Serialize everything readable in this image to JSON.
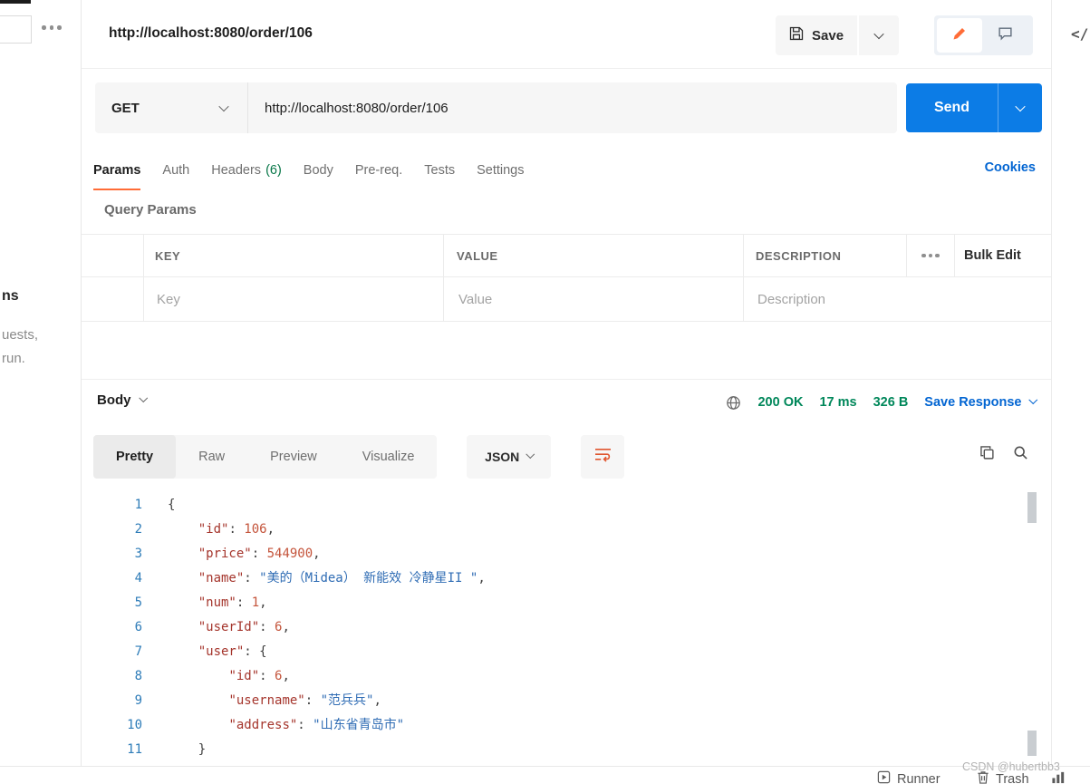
{
  "colors": {
    "accent_orange": "#FF6C37",
    "send_blue": "#0C7CE6",
    "link_blue": "#0265D2",
    "success_green": "#00875A",
    "code_key": "#A5352C",
    "code_number": "#C4543B",
    "code_string": "#2F6CB4",
    "code_line_number": "#2E7CB8"
  },
  "sidebar": {
    "line1": "ns",
    "line2": "uests,",
    "line3": "run."
  },
  "header": {
    "title": "http://localhost:8080/order/106",
    "save": "Save",
    "console": "</"
  },
  "request": {
    "method": "GET",
    "url": "http://localhost:8080/order/106",
    "send": "Send"
  },
  "tabs": {
    "params": "Params",
    "auth": "Auth",
    "headers": "Headers",
    "headers_count": "(6)",
    "body": "Body",
    "prereq": "Pre-req.",
    "tests": "Tests",
    "settings": "Settings",
    "cookies": "Cookies"
  },
  "query_params": {
    "title": "Query Params",
    "col_key": "KEY",
    "col_value": "VALUE",
    "col_description": "DESCRIPTION",
    "bulk_edit": "Bulk Edit",
    "ph_key": "Key",
    "ph_value": "Value",
    "ph_description": "Description"
  },
  "response": {
    "body": "Body",
    "status": "200 OK",
    "time": "17 ms",
    "size": "326 B",
    "save_response": "Save Response",
    "pretty": "Pretty",
    "raw": "Raw",
    "preview": "Preview",
    "visualize": "Visualize",
    "format": "JSON"
  },
  "code": {
    "lines": [
      {
        "num": "1",
        "tokens": [
          {
            "t": "p",
            "v": "{"
          }
        ]
      },
      {
        "num": "2",
        "tokens": [
          {
            "t": "p",
            "v": "    "
          },
          {
            "t": "k",
            "v": "\"id\""
          },
          {
            "t": "p",
            "v": ": "
          },
          {
            "t": "n",
            "v": "106"
          },
          {
            "t": "p",
            "v": ","
          }
        ]
      },
      {
        "num": "3",
        "tokens": [
          {
            "t": "p",
            "v": "    "
          },
          {
            "t": "k",
            "v": "\"price\""
          },
          {
            "t": "p",
            "v": ": "
          },
          {
            "t": "n",
            "v": "544900"
          },
          {
            "t": "p",
            "v": ","
          }
        ]
      },
      {
        "num": "4",
        "tokens": [
          {
            "t": "p",
            "v": "    "
          },
          {
            "t": "k",
            "v": "\"name\""
          },
          {
            "t": "p",
            "v": ": "
          },
          {
            "t": "s",
            "v": "\"美的（Midea） 新能效 冷静星II \""
          },
          {
            "t": "p",
            "v": ","
          }
        ]
      },
      {
        "num": "5",
        "tokens": [
          {
            "t": "p",
            "v": "    "
          },
          {
            "t": "k",
            "v": "\"num\""
          },
          {
            "t": "p",
            "v": ": "
          },
          {
            "t": "n",
            "v": "1"
          },
          {
            "t": "p",
            "v": ","
          }
        ]
      },
      {
        "num": "6",
        "tokens": [
          {
            "t": "p",
            "v": "    "
          },
          {
            "t": "k",
            "v": "\"userId\""
          },
          {
            "t": "p",
            "v": ": "
          },
          {
            "t": "n",
            "v": "6"
          },
          {
            "t": "p",
            "v": ","
          }
        ]
      },
      {
        "num": "7",
        "tokens": [
          {
            "t": "p",
            "v": "    "
          },
          {
            "t": "k",
            "v": "\"user\""
          },
          {
            "t": "p",
            "v": ": {"
          }
        ]
      },
      {
        "num": "8",
        "tokens": [
          {
            "t": "p",
            "v": "        "
          },
          {
            "t": "k",
            "v": "\"id\""
          },
          {
            "t": "p",
            "v": ": "
          },
          {
            "t": "n",
            "v": "6"
          },
          {
            "t": "p",
            "v": ","
          }
        ]
      },
      {
        "num": "9",
        "tokens": [
          {
            "t": "p",
            "v": "        "
          },
          {
            "t": "k",
            "v": "\"username\""
          },
          {
            "t": "p",
            "v": ": "
          },
          {
            "t": "s",
            "v": "\"范兵兵\""
          },
          {
            "t": "p",
            "v": ","
          }
        ]
      },
      {
        "num": "10",
        "tokens": [
          {
            "t": "p",
            "v": "        "
          },
          {
            "t": "k",
            "v": "\"address\""
          },
          {
            "t": "p",
            "v": ": "
          },
          {
            "t": "s",
            "v": "\"山东省青岛市\""
          }
        ]
      },
      {
        "num": "11",
        "tokens": [
          {
            "t": "p",
            "v": "    }"
          }
        ]
      }
    ]
  },
  "footer": {
    "runner": "Runner",
    "trash": "Trash",
    "watermark": "CSDN @hubertbb3"
  }
}
